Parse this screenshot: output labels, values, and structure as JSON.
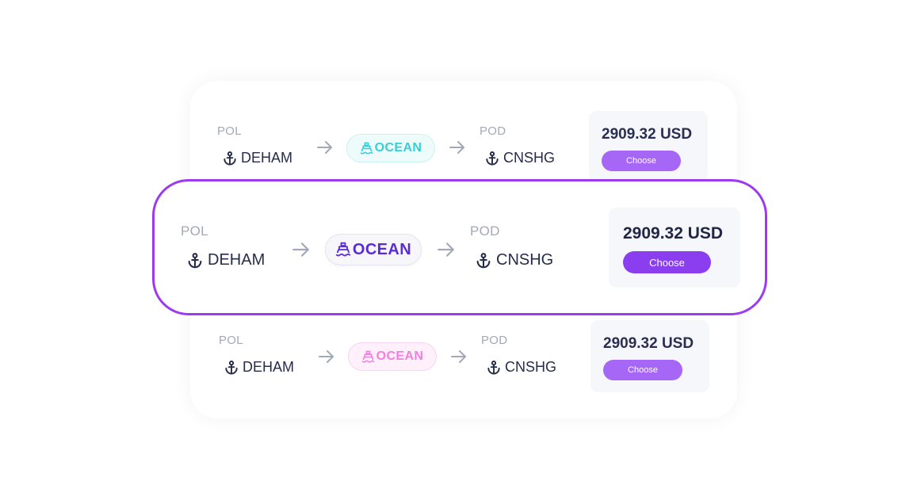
{
  "rows": [
    {
      "variant": "top",
      "pol_label": "POL",
      "pol_code": "DEHAM",
      "pod_label": "POD",
      "pod_code": "CNSHG",
      "mode_label": "OCEAN",
      "mode_icon": "ship-icon",
      "price": "2909.32 USD",
      "button_label": "Choose",
      "accent_color": "#36cfd6"
    },
    {
      "variant": "focused",
      "pol_label": "POL",
      "pol_code": "DEHAM",
      "pod_label": "POD",
      "pod_code": "CNSHG",
      "mode_label": "OCEAN",
      "mode_icon": "ship-icon",
      "price": "2909.32 USD",
      "button_label": "Choose",
      "accent_color": "#5a2bd8"
    },
    {
      "variant": "bottom",
      "pol_label": "POL",
      "pol_code": "DEHAM",
      "pod_label": "POD",
      "pod_code": "CNSHG",
      "mode_label": "OCEAN",
      "mode_icon": "ship-icon",
      "price": "2909.32 USD",
      "button_label": "Choose",
      "accent_color": "#f07fe1"
    }
  ],
  "icons": {
    "location": "anchor-icon",
    "direction": "arrow-right-icon"
  },
  "colors": {
    "highlight_border": "#9b3af0",
    "button_primary": "#8a3ef0",
    "button_secondary": "#a666f6",
    "price_box_bg": "#f5f7fa"
  }
}
